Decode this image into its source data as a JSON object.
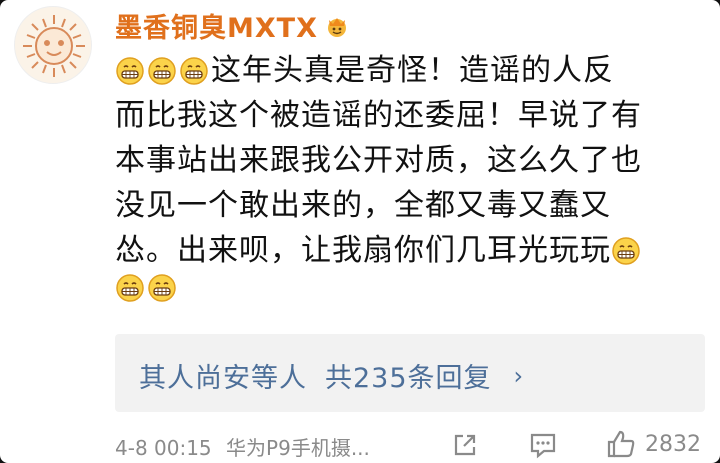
{
  "comment": {
    "username": "墨香铜臭MXTX",
    "lines": [
      "这年头真是奇怪！造谣的人反",
      "而比我这个被造谣的还委屈！早说了有",
      "本事站出来跟我公开对质，这么久了也",
      "没见一个敢出来的，全都又毒又蠢又",
      "怂。出来呗，让我扇你们几耳光玩玩"
    ],
    "emoji_icon": "grinning-face-icon"
  },
  "replies": {
    "names": "其人尚安等人",
    "count": "共235条回复",
    "chevron": "›"
  },
  "footer": {
    "date": "4-8 00:15",
    "source": "华为P9手机摄...",
    "like_count": "2832"
  }
}
